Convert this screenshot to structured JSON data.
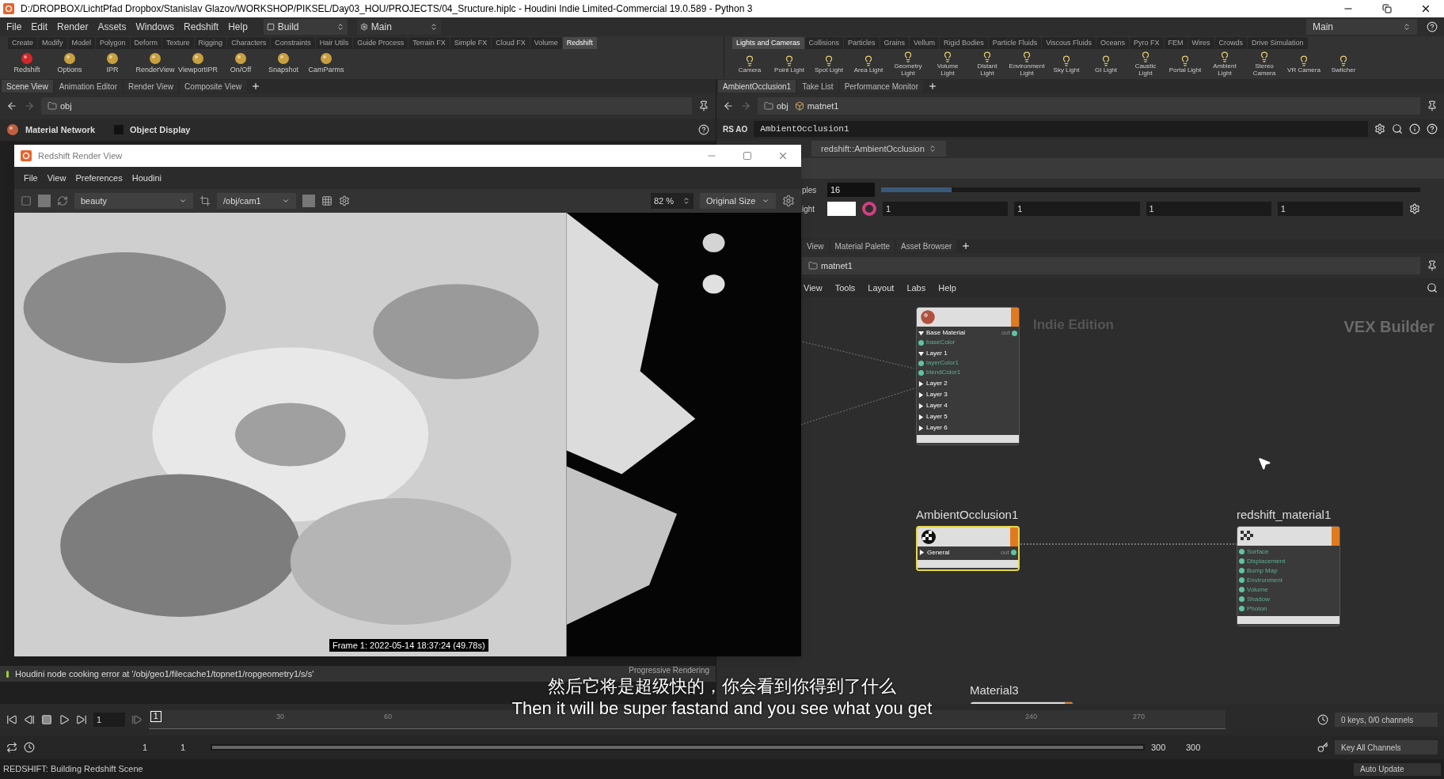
{
  "title_bar": {
    "title": "D:/DROPBOX/LichtPfad Dropbox/Stanislav Glazov/WORKSHOP/PIKSEL/Day03_HOU/PROJECTS/04_Sructure.hiplc - Houdini Indie Limited-Commercial 19.0.589 - Python 3"
  },
  "menu_bar": {
    "items": [
      "File",
      "Edit",
      "Render",
      "Assets",
      "Windows",
      "Redshift",
      "Help"
    ],
    "desktop": "Build",
    "layout": "Main",
    "right_layout": "Main"
  },
  "left_shelf": {
    "tabs": [
      {
        "label": "Create",
        "selected": false
      },
      {
        "label": "Modify",
        "selected": false
      },
      {
        "label": "Model",
        "selected": false
      },
      {
        "label": "Polygon",
        "selected": false
      },
      {
        "label": "Deform",
        "selected": false
      },
      {
        "label": "Texture",
        "selected": false
      },
      {
        "label": "Rigging",
        "selected": false
      },
      {
        "label": "Characters",
        "selected": false
      },
      {
        "label": "Constraints",
        "selected": false
      },
      {
        "label": "Hair Utils",
        "selected": false
      },
      {
        "label": "Guide Process",
        "selected": false
      },
      {
        "label": "Terrain FX",
        "selected": false
      },
      {
        "label": "Simple FX",
        "selected": false
      },
      {
        "label": "Cloud FX",
        "selected": false
      },
      {
        "label": "Volume",
        "selected": false
      },
      {
        "label": "Redshift",
        "selected": true
      }
    ],
    "tools": [
      "Redshift",
      "Options",
      "IPR",
      "RenderView",
      "ViewportIPR",
      "On/Off",
      "Snapshot",
      "CamParms"
    ]
  },
  "right_shelf": {
    "tabs": [
      {
        "label": "Lights and Cameras",
        "selected": true
      },
      {
        "label": "Collisions",
        "selected": false
      },
      {
        "label": "Particles",
        "selected": false
      },
      {
        "label": "Grains",
        "selected": false
      },
      {
        "label": "Vellum",
        "selected": false
      },
      {
        "label": "Rigid Bodies",
        "selected": false
      },
      {
        "label": "Particle Fluids",
        "selected": false
      },
      {
        "label": "Viscous Fluids",
        "selected": false
      },
      {
        "label": "Oceans",
        "selected": false
      },
      {
        "label": "Pyro FX",
        "selected": false
      },
      {
        "label": "FEM",
        "selected": false
      },
      {
        "label": "Wires",
        "selected": false
      },
      {
        "label": "Crowds",
        "selected": false
      },
      {
        "label": "Drive Simulation",
        "selected": false
      }
    ],
    "tools": [
      "Camera",
      "Point Light",
      "Spot Light",
      "Area Light",
      "Geometry Light",
      "Volume Light",
      "Distant Light",
      "Environment Light",
      "Sky Light",
      "GI Light",
      "Caustic Light",
      "Portal Light",
      "Ambient Light",
      "Stereo Camera",
      "VR Camera",
      "Switcher"
    ]
  },
  "left_pane": {
    "tabs": [
      {
        "label": "Scene View",
        "selected": true
      },
      {
        "label": "Animation Editor",
        "selected": false
      },
      {
        "label": "Render View",
        "selected": false
      },
      {
        "label": "Composite View",
        "selected": false
      }
    ],
    "path": "obj",
    "network_header": {
      "title": "Material Network",
      "option": {
        "label": "Object Display",
        "checked": false
      }
    },
    "error": "Houdini node cooking error at '/obj/geo1/filecache1/topnet1/ropgeometry1/s/s'",
    "progress_label": "Progressive Rendering"
  },
  "render_view": {
    "title": "Redshift Render View",
    "menu": [
      "File",
      "View",
      "Preferences",
      "Houdini"
    ],
    "aov": "beauty",
    "camera": "/obj/cam1",
    "zoom": "82 %",
    "size_mode": "Original Size",
    "frame_info": "Frame 1: 2022-05-14 18:37:24 (49.78s)"
  },
  "right_pane": {
    "tabs": [
      {
        "label": "AmbientOcclusion1",
        "selected": true
      },
      {
        "label": "Take List",
        "selected": false
      },
      {
        "label": "Performance Monitor",
        "selected": false
      }
    ],
    "path": [
      "obj",
      "matnet1"
    ],
    "node_type": "RS AO",
    "node_name": "AmbientOcclusion1",
    "shader": "redshift::AmbientOcclusion",
    "parameters": [
      {
        "kind": "slider",
        "label": "ples",
        "value": "16",
        "level": 0.13
      },
      {
        "kind": "color",
        "label": "ight",
        "values": [
          "1",
          "1",
          "1",
          "1"
        ]
      }
    ]
  },
  "network_pane": {
    "tabs": [
      {
        "label": "View",
        "selected": false
      },
      {
        "label": "Material Palette",
        "selected": false
      },
      {
        "label": "Asset Browser",
        "selected": false
      }
    ],
    "path": "matnet1",
    "menu": [
      "View",
      "Tools",
      "Layout",
      "Labs",
      "Help"
    ],
    "context_labels": [
      "Indie Edition",
      "VEX Builder"
    ],
    "nodes": [
      {
        "kind": "layer",
        "selected": false,
        "rows": [
          {
            "kind": "group",
            "label": "Base Material",
            "expanded": true,
            "output": "out"
          },
          {
            "kind": "input",
            "label": "baseColor"
          },
          {
            "kind": "group",
            "label": "Layer 1",
            "expanded": true
          },
          {
            "kind": "input",
            "label": "layerColor1"
          },
          {
            "kind": "input",
            "label": "blendColor1"
          },
          {
            "kind": "group",
            "label": "Layer 2",
            "expanded": false
          },
          {
            "kind": "group",
            "label": "Layer 3",
            "expanded": false
          },
          {
            "kind": "group",
            "label": "Layer 4",
            "expanded": false
          },
          {
            "kind": "group",
            "label": "Layer 5",
            "expanded": false
          },
          {
            "kind": "group",
            "label": "Layer 6",
            "expanded": false
          }
        ]
      },
      {
        "kind": "ao",
        "title": "AmbientOcclusion1",
        "selected": true,
        "rows": [
          {
            "kind": "group",
            "label": "General",
            "expanded": false,
            "output": "out"
          }
        ]
      },
      {
        "kind": "material",
        "title": "redshift_material1",
        "selected": false,
        "rows": [
          {
            "kind": "input",
            "label": "Surface"
          },
          {
            "kind": "input",
            "label": "Displacement"
          },
          {
            "kind": "input",
            "label": "Bump Map"
          },
          {
            "kind": "input",
            "label": "Environment"
          },
          {
            "kind": "input",
            "label": "Volume"
          },
          {
            "kind": "input",
            "label": "Shadow"
          },
          {
            "kind": "input",
            "label": "Photon"
          }
        ]
      },
      {
        "kind": "material",
        "title": "Material3",
        "selected": false
      }
    ]
  },
  "timeline": {
    "current_frame": "1",
    "marker": "1",
    "tick_labels": [
      "30",
      "60",
      "240",
      "270"
    ],
    "range": [
      "1",
      "1",
      "300",
      "300"
    ],
    "range_bar": {
      "level": 1
    },
    "keys": "0 keys, 0/0 channels",
    "key_button": "Key All Channels"
  },
  "status_bar": {
    "message": "REDSHIFT: Building Redshift Scene",
    "update_mode": "Auto Update"
  },
  "subtitles": {
    "zh": "然后它将是超级快的，你会看到你得到了什么",
    "en": "Then it will be super fastand and you see what you get"
  }
}
